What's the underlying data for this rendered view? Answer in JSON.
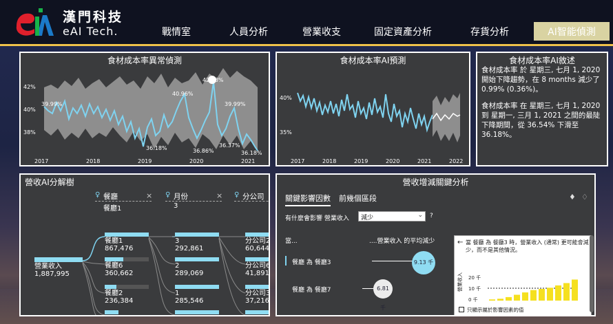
{
  "brand": {
    "cn": "漢門科技",
    "en": "eAI Tech."
  },
  "nav": {
    "tabs": [
      "戰情室",
      "人員分析",
      "營業收支",
      "固定資產分析",
      "存貨分析",
      "AI智能偵測"
    ],
    "active": 5
  },
  "colors": {
    "accent": "#f0c24a",
    "line": "#7fd3f0",
    "band": "#8e8e8e",
    "bar": "#f5e020"
  },
  "anomaly": {
    "title": "食材成本率異常偵測",
    "y_ticks": [
      "42%",
      "40%",
      "38%"
    ],
    "x_ticks": [
      "2017",
      "2018",
      "2019",
      "2020",
      "2021"
    ],
    "labels": [
      "39.99%",
      "40.96%",
      "42.38%",
      "39.99%",
      "36.18%",
      "36.86%",
      "36.37%",
      "36.18%"
    ]
  },
  "forecast": {
    "title": "食材成本率AI預測",
    "y_ticks": [
      "40%",
      "35%"
    ],
    "x_ticks": [
      "2017",
      "2018",
      "2019",
      "2020",
      "2021",
      "2022"
    ]
  },
  "narrative": {
    "title": "食材成本率AI敘述",
    "p1": "食材成本率 於 星期三, 七月 1, 2020 開始下降趨勢，在 8 months 減少了 0.99% (0.36%)。",
    "p2": "食材成本率 在 星期三, 七月 1, 2020 到 星期一, 三月 1, 2021 之間的最陡下降期間，從 36.54% 下滑至 36.18%。"
  },
  "decomp": {
    "title": "營收AI分解樹",
    "levels": [
      {
        "name": "餐廳",
        "sub": "餐廳1"
      },
      {
        "name": "月份",
        "sub": "3"
      },
      {
        "name": "分公司",
        "sub": ""
      }
    ],
    "root": {
      "label": "營業收入",
      "value": "1,887,995"
    },
    "col1": [
      {
        "label": "餐廳1",
        "value": "867,476",
        "pct": 1.0
      },
      {
        "label": "餐廳6",
        "value": "360,662",
        "pct": 0.42
      },
      {
        "label": "餐廳2",
        "value": "236,384",
        "pct": 0.27
      }
    ],
    "col2": [
      {
        "label": "3",
        "value": "292,861",
        "pct": 1.0
      },
      {
        "label": "2",
        "value": "289,069",
        "pct": 0.99
      },
      {
        "label": "1",
        "value": "285,546",
        "pct": 0.97
      }
    ],
    "col3": [
      {
        "label": "分公司2",
        "value": "60,644"
      },
      {
        "label": "分公司6",
        "value": "41,891"
      },
      {
        "label": "分公司3",
        "value": "37,216"
      }
    ]
  },
  "keyinf": {
    "title": "營收增減關鍵分析",
    "tab1": "關鍵影響因數",
    "tab2": "前幾個區段",
    "question_prefix": "有什麼會影響 營業收入",
    "dropdown": "減少",
    "q_mark": "?",
    "col_when": "當...",
    "col_avg": "....營業收入 的平均減少",
    "row1": {
      "label": "餐廳 為 餐廳3",
      "value": "9.13 千"
    },
    "row2": {
      "label": "餐廳 為 餐廳7",
      "value": "6.81 千"
    },
    "callout": {
      "text": "當 餐廳 為 餐廳3 時，營業收入 (通常) 更可能會減少，而不是其他情況。",
      "y_label": "營業收入",
      "y_ticks": [
        "20 千",
        "10 千",
        "0 千"
      ],
      "bars": [
        0.05,
        0.08,
        0.15,
        0.25,
        0.35,
        0.45,
        0.5,
        0.55,
        0.65,
        0.75,
        0.9
      ],
      "checkbox": "只顯示屬於影響因素的值"
    }
  }
}
